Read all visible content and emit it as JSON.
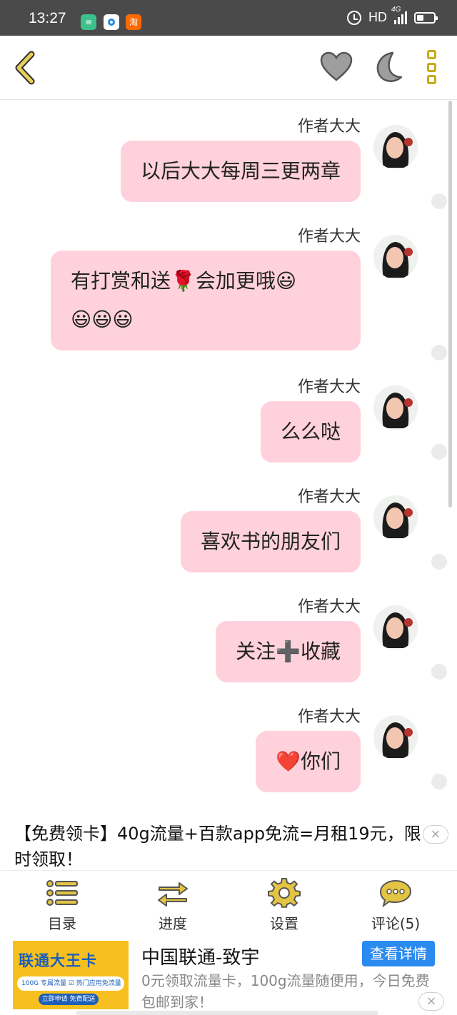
{
  "status_bar": {
    "time": "13:27",
    "app_icons": [
      "≡",
      "",
      "淘"
    ],
    "network": "HD",
    "signal_label": "4G"
  },
  "nav": {
    "icons": [
      "back-icon",
      "heart-icon",
      "moon-icon",
      "more-icon"
    ],
    "accent_color": "#c9aa1c"
  },
  "messages": [
    {
      "author": "作者大大",
      "text": "以后大大每周三更两章"
    },
    {
      "author": "作者大大",
      "text": "有打赏和送🌹会加更哦😃",
      "text2": "😃😃😃"
    },
    {
      "author": "作者大大",
      "text": "么么哒"
    },
    {
      "author": "作者大大",
      "text": "喜欢书的朋友们"
    },
    {
      "author": "作者大大",
      "text": "关注➕收藏"
    },
    {
      "author": "作者大大",
      "text": "❤️你们"
    }
  ],
  "ad_banner": {
    "text": "【免费领卡】40g流量+百款app免流=月租19元，限时领取！",
    "close": "×"
  },
  "toolbar": [
    {
      "label": "目录",
      "icon": "catalog-icon"
    },
    {
      "label": "进度",
      "icon": "progress-icon"
    },
    {
      "label": "设置",
      "icon": "settings-icon"
    },
    {
      "label": "评论(5)",
      "icon": "comment-icon"
    }
  ],
  "bottom_ad": {
    "image_title": "联通大王卡",
    "image_band": "100G 专属流量 ☑ 热门应用免流量",
    "image_button": "立即申请 免费配送",
    "title": "中国联通-致宇",
    "cta": "查看详情",
    "description": "0元领取流量卡，100g流量随便用，今日免费包邮到家！",
    "close": "×"
  },
  "colors": {
    "bubble": "#ffd1dc",
    "status_bar": "#4a4a4a",
    "cta": "#2b8af0"
  }
}
